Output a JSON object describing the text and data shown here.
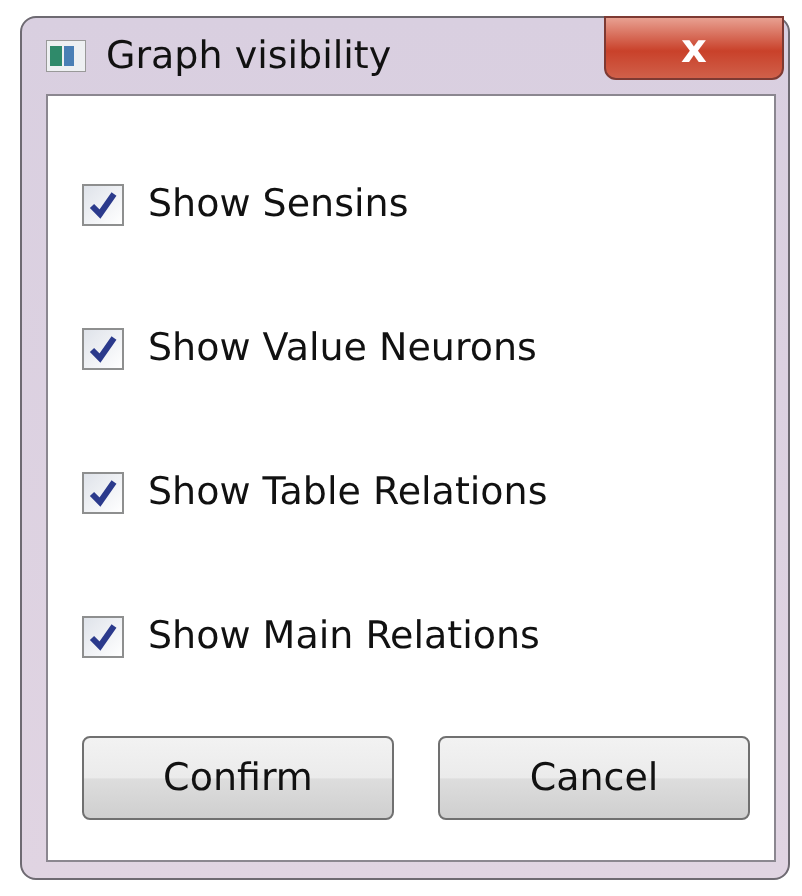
{
  "window": {
    "title": "Graph visibility",
    "close": "x"
  },
  "options": [
    {
      "label": "Show Sensins",
      "checked": true
    },
    {
      "label": "Show Value Neurons",
      "checked": true
    },
    {
      "label": "Show Table Relations",
      "checked": true
    },
    {
      "label": "Show Main Relations",
      "checked": true
    }
  ],
  "buttons": [
    "Confirm",
    "Cancel"
  ]
}
